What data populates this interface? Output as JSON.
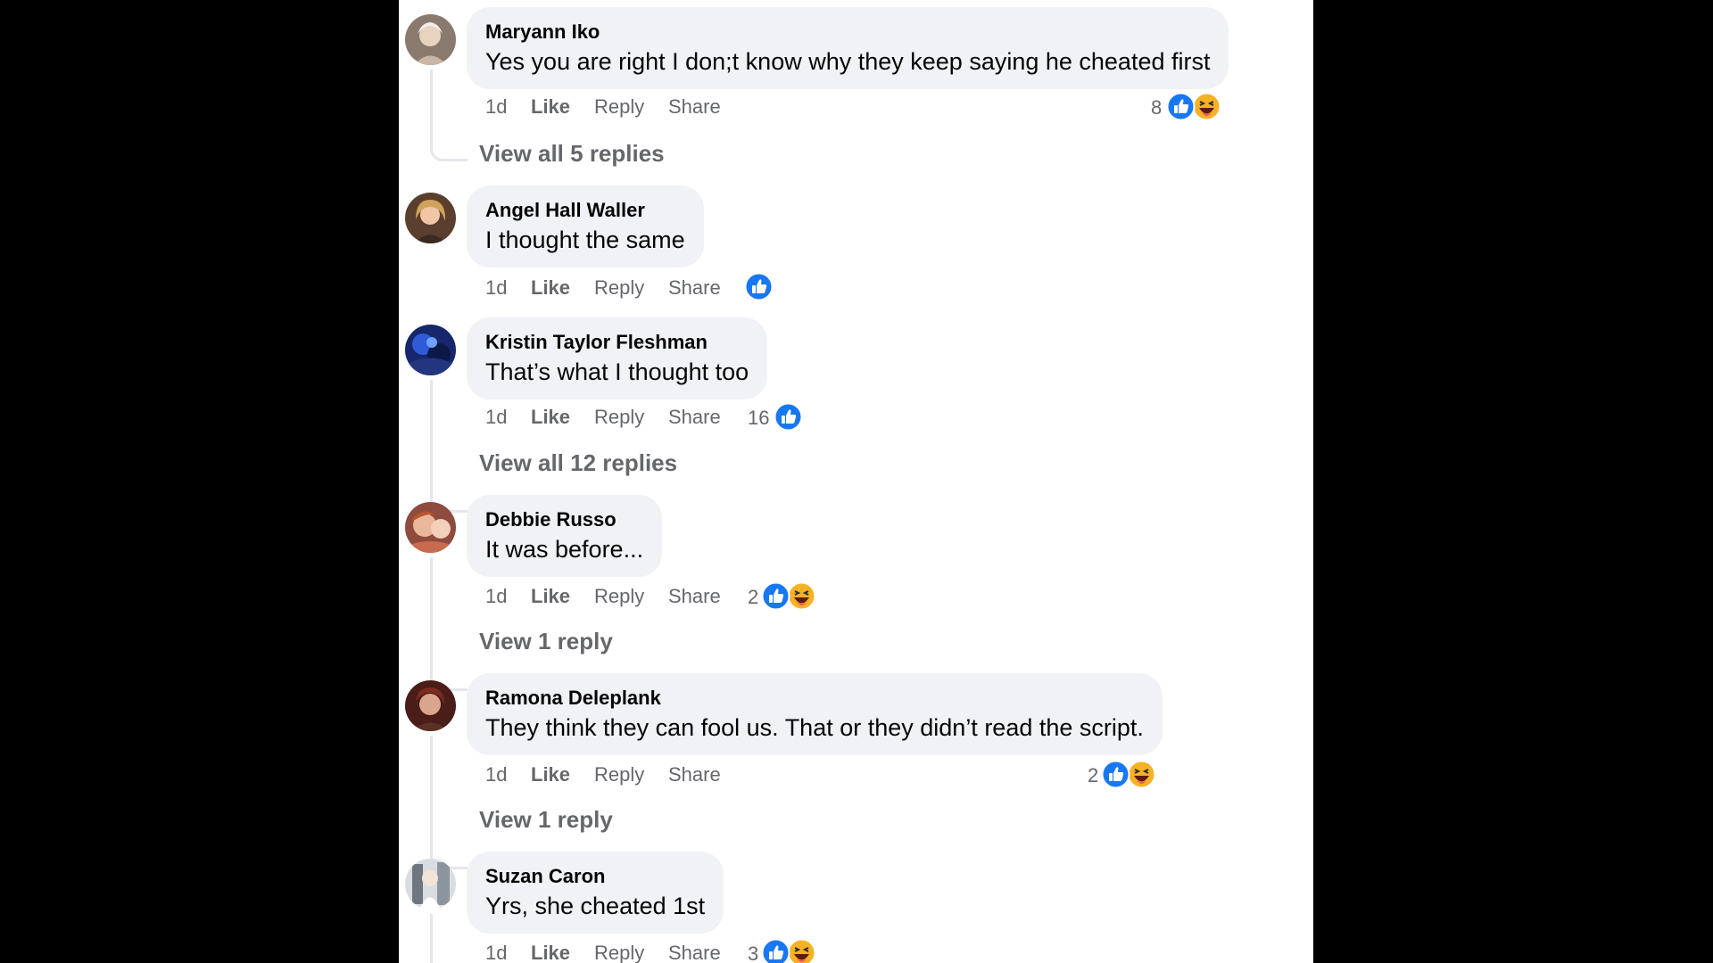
{
  "comments": [
    {
      "author": "Maryann Iko",
      "text": "Yes you are right I don;t know why they keep saying he cheated first",
      "time": "1d",
      "like": "Like",
      "reply": "Reply",
      "share": "Share",
      "reaction_count": "8",
      "reactions": [
        "like-icon",
        "haha-icon"
      ],
      "view_replies": "View all 5 replies"
    },
    {
      "author": "Angel Hall Waller",
      "text": "I thought the same",
      "time": "1d",
      "like": "Like",
      "reply": "Reply",
      "share": "Share",
      "reaction_count": "",
      "reactions": [
        "like-icon"
      ],
      "view_replies": ""
    },
    {
      "author": "Kristin Taylor Fleshman",
      "text": "That’s what I thought too",
      "time": "1d",
      "like": "Like",
      "reply": "Reply",
      "share": "Share",
      "reaction_count": "16",
      "reactions": [
        "like-icon"
      ],
      "view_replies": "View all 12 replies"
    },
    {
      "author": "Debbie Russo",
      "text": "It was before...",
      "time": "1d",
      "like": "Like",
      "reply": "Reply",
      "share": "Share",
      "reaction_count": "2",
      "reactions": [
        "like-icon",
        "haha-icon"
      ],
      "view_replies": "View 1 reply"
    },
    {
      "author": "Ramona Deleplank",
      "text": "They think they can fool us. That or they didn’t read the script.",
      "time": "1d",
      "like": "Like",
      "reply": "Reply",
      "share": "Share",
      "reaction_count": "2",
      "reactions": [
        "like-icon",
        "haha-icon"
      ],
      "view_replies": "View 1 reply"
    },
    {
      "author": "Suzan Caron",
      "text": "Yrs, she cheated 1st",
      "time": "1d",
      "like": "Like",
      "reply": "Reply",
      "share": "Share",
      "reaction_count": "3",
      "reactions": [
        "like-icon",
        "haha-icon"
      ],
      "view_replies": ""
    }
  ],
  "colors": {
    "background": "#000000",
    "panel": "#ffffff",
    "bubble": "#f0f2f5",
    "muted_text": "#65676b",
    "like_blue": "#1877f2",
    "haha_yellow": "#f7b125"
  }
}
